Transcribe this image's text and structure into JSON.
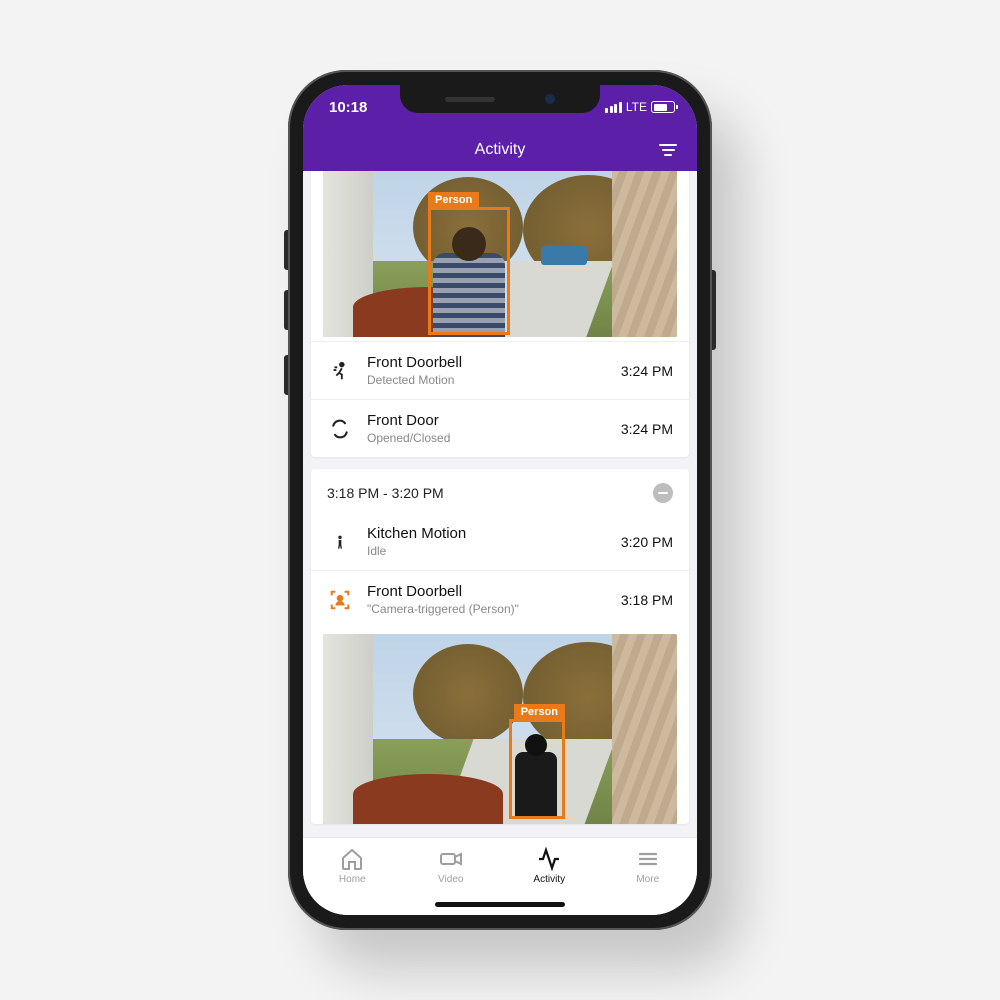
{
  "status": {
    "time": "10:18",
    "network": "LTE"
  },
  "nav": {
    "title": "Activity"
  },
  "detection_label": "Person",
  "events_group1": [
    {
      "title": "Front Doorbell",
      "sub": "Detected Motion",
      "time": "3:24 PM"
    },
    {
      "title": "Front Door",
      "sub": "Opened/Closed",
      "time": "3:24 PM"
    }
  ],
  "group2": {
    "range": "3:18 PM - 3:20 PM",
    "events": [
      {
        "title": "Kitchen Motion",
        "sub": "Idle",
        "time": "3:20 PM"
      },
      {
        "title": "Front Doorbell",
        "sub": "\"Camera-triggered (Person)\"",
        "time": "3:18 PM"
      }
    ]
  },
  "tabs": {
    "home": "Home",
    "video": "Video",
    "activity": "Activity",
    "more": "More"
  }
}
